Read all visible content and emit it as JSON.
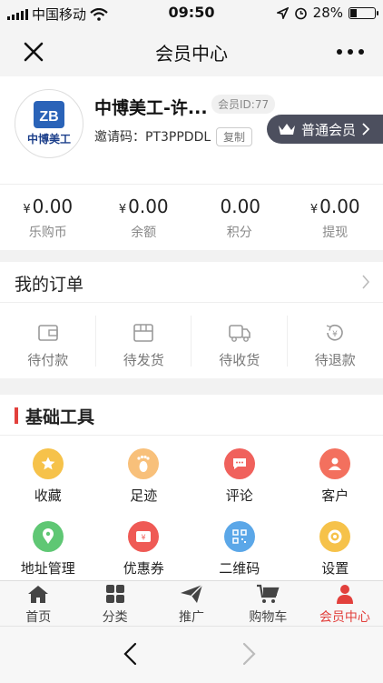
{
  "status_bar": {
    "carrier": "中国移动",
    "time": "09:50",
    "battery": "28%",
    "icons": [
      "signal-icon",
      "wifi-icon",
      "location-icon",
      "alarm-icon",
      "battery-icon"
    ]
  },
  "header": {
    "title": "会员中心",
    "close_icon": "close-icon",
    "more_icon": "more-icon"
  },
  "profile": {
    "name": "中博美工-许...",
    "member_id": "会员ID:77",
    "invite_code": "邀请码：PT3PPDDL",
    "copy_label": "复制",
    "vip_label": "普通会员",
    "avatar_text": "中博美工",
    "avatar_logo": "ZB"
  },
  "balances": [
    {
      "prefix": "¥",
      "value": "0.00",
      "label": "乐购币"
    },
    {
      "prefix": "¥",
      "value": "0.00",
      "label": "余额"
    },
    {
      "prefix": "",
      "value": "0.00",
      "label": "积分"
    },
    {
      "prefix": "¥",
      "value": "0.00",
      "label": "提现"
    }
  ],
  "orders": {
    "title": "我的订单",
    "items": [
      {
        "label": "待付款",
        "icon": "wallet-icon"
      },
      {
        "label": "待发货",
        "icon": "package-icon"
      },
      {
        "label": "待收货",
        "icon": "truck-icon"
      },
      {
        "label": "待退款",
        "icon": "refund-icon"
      }
    ]
  },
  "tools": {
    "title": "基础工具",
    "accent": "#e2403c",
    "items": [
      {
        "label": "收藏",
        "icon": "star-icon",
        "color": "#f6c24a"
      },
      {
        "label": "足迹",
        "icon": "footprint-icon",
        "color": "#f8c07a"
      },
      {
        "label": "评论",
        "icon": "comment-icon",
        "color": "#f0615c"
      },
      {
        "label": "客户",
        "icon": "customer-icon",
        "color": "#f3705e"
      },
      {
        "label": "地址管理",
        "icon": "location-pin-icon",
        "color": "#5fc774"
      },
      {
        "label": "优惠券",
        "icon": "coupon-icon",
        "color": "#ef5a55"
      },
      {
        "label": "二维码",
        "icon": "qrcode-icon",
        "color": "#5ba7e8"
      },
      {
        "label": "设置",
        "icon": "settings-icon",
        "color": "#f6c24a"
      }
    ]
  },
  "tabbar": {
    "active_color": "#e2403c",
    "items": [
      {
        "label": "首页",
        "icon": "home-icon"
      },
      {
        "label": "分类",
        "icon": "grid-icon"
      },
      {
        "label": "推广",
        "icon": "send-icon"
      },
      {
        "label": "购物车",
        "icon": "cart-icon"
      },
      {
        "label": "会员中心",
        "icon": "user-icon",
        "active": true
      }
    ]
  },
  "browser": {
    "back_icon": "back-arrow-icon",
    "forward_icon": "forward-arrow-icon"
  }
}
